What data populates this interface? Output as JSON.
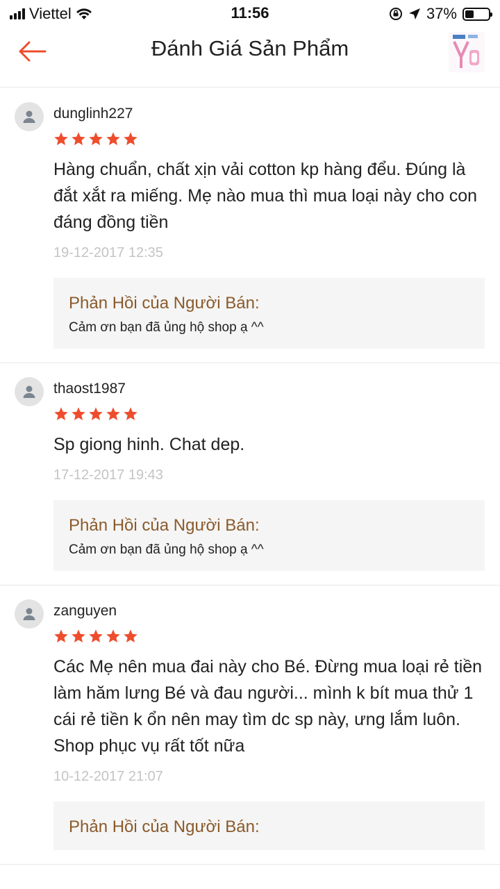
{
  "status_bar": {
    "carrier": "Viettel",
    "time": "11:56",
    "battery_percent": "37%",
    "battery_level": 0.37
  },
  "nav": {
    "title": "Đánh Giá Sản Phẩm",
    "back_icon": "arrow-left-icon",
    "accent_color": "#ee4d2d"
  },
  "seller_reply_title": "Phản Hồi của Người Bán:",
  "reviews": [
    {
      "username": "dunglinh227",
      "rating": 5,
      "text": "Hàng chuẩn, chất xịn vải cotton kp hàng đểu. Đúng là đắt xắt ra miếng. Mẹ nào mua thì mua loại này cho con đáng đồng tiền",
      "date": "19-12-2017 12:35",
      "reply_title": "Phản Hồi của Người Bán:",
      "reply": "Cảm ơn bạn đã ủng hộ shop ạ ^^"
    },
    {
      "username": "thaost1987",
      "rating": 5,
      "text": "Sp giong hinh. Chat dep.",
      "date": "17-12-2017 19:43",
      "reply_title": "Phản Hồi của Người Bán:",
      "reply": "Cảm ơn bạn đã ủng hộ shop ạ ^^"
    },
    {
      "username": "zanguyen",
      "rating": 5,
      "text": "Các Mẹ nên mua đai này cho Bé. Đừng mua loại rẻ tiền làm hăm lưng Bé và đau người... mình k bít mua thử 1 cái rẻ tiền k ổn nên may tìm dc sp này, ưng lắm luôn. Shop phục vụ rất tốt nữa",
      "date": "10-12-2017 21:07",
      "reply_title": "Phản Hồi của Người Bán:",
      "reply": ""
    }
  ],
  "colors": {
    "star": "#ee4d2d",
    "reply_title": "#8a5a2b",
    "date": "#c4c4c4",
    "reply_bg": "#f5f5f5"
  }
}
